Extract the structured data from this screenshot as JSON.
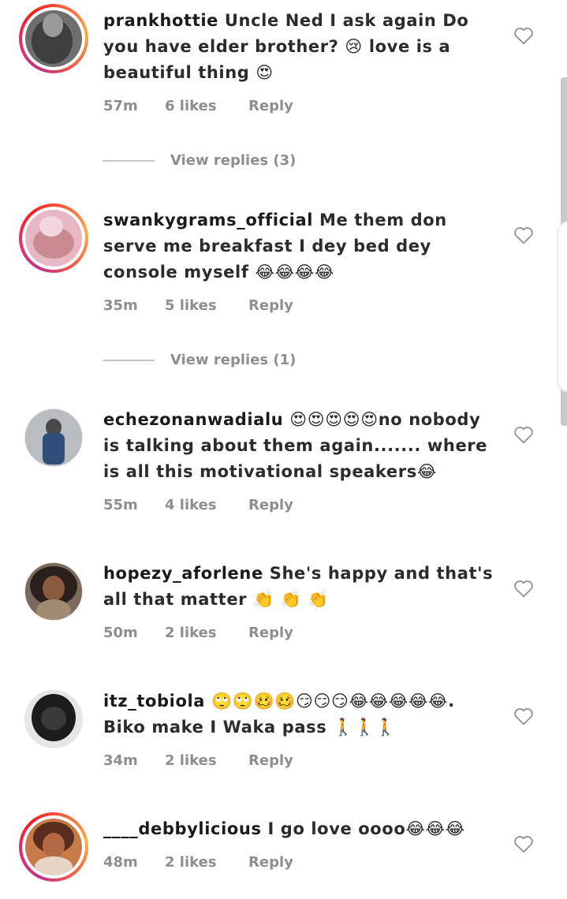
{
  "comments": [
    {
      "username": "prankhottie",
      "text": "Uncle Ned I ask again Do you have elder brother? 😢 love is a beautiful thing 😍",
      "time": "57m",
      "likes": "6 likes",
      "reply": "Reply",
      "view_replies": "View replies (3)"
    },
    {
      "username": "swankygrams_official",
      "text": "Me them don serve me breakfast I dey bed dey console myself 😂😂😂😂",
      "time": "35m",
      "likes": "5 likes",
      "reply": "Reply",
      "view_replies": "View replies (1)"
    },
    {
      "username": "echezonanwadialu",
      "text": "😍😍😍😍😍no nobody is talking about them again....... where is all this motivational speakers😂",
      "time": "55m",
      "likes": "4 likes",
      "reply": "Reply"
    },
    {
      "username": "hopezy_aforlene",
      "text": "She's happy and that's all that matter 👏 👏 👏",
      "time": "50m",
      "likes": "2 likes",
      "reply": "Reply"
    },
    {
      "username": "itz_tobiola",
      "text": "🙄🙄🥴🥴😏😏😏😂😂😂😂😂. Biko make I Waka pass 🚶🚶🚶",
      "time": "34m",
      "likes": "2 likes",
      "reply": "Reply"
    },
    {
      "username": "____debbylicious",
      "text": "I go love oooo😂😂😂",
      "time": "48m",
      "likes": "2 likes",
      "reply": "Reply"
    }
  ],
  "icons": {
    "like": "heart-outline-icon"
  },
  "colors": {
    "text": "#262626",
    "muted": "#8e8e8e",
    "story_ring": [
      "#c13584",
      "#e1306c",
      "#fd1d1d",
      "#f56040",
      "#fcaf45"
    ]
  }
}
